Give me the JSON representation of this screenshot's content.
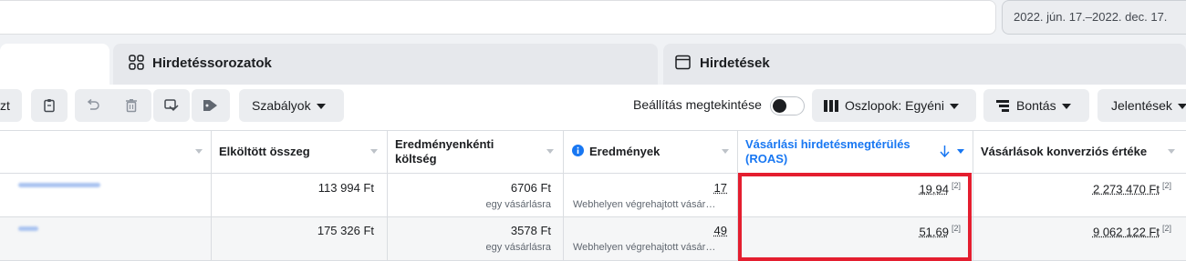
{
  "date_range": "2022. jún. 17.–2022. dec. 17.",
  "tabs": [
    {
      "label": "Hirdetéssorozatok",
      "icon": "ad-sets-grid-icon"
    },
    {
      "label": "Hirdetések",
      "icon": "ads-window-icon"
    }
  ],
  "toolbar": {
    "partial_label": "zt",
    "rules_label": "Szabályok",
    "preview_label": "Beállítás megtekintése",
    "columns_label": "Oszlopok: Egyéni",
    "breakdown_label": "Bontás",
    "reports_label": "Jelentések"
  },
  "table": {
    "headers": {
      "spent": "Elköltött összeg",
      "cost_per_result": "Eredményenkénti költség",
      "results": "Eredmények",
      "roas": "Vásárlási hirdetésmegtérülés (ROAS)",
      "conversion_value": "Vásárlások konverziós értéke"
    },
    "rows": [
      {
        "spent": "113 994 Ft",
        "cost_per_result": "6706 Ft",
        "cost_per_result_sub": "egy vásárlásra",
        "results": "17",
        "results_sub": "Webhelyen végrehajtott vásár…",
        "roas": "19,94",
        "roas_note": "[2]",
        "conversion_value": "2 273 470 Ft",
        "conversion_note": "[2]"
      },
      {
        "spent": "175 326 Ft",
        "cost_per_result": "3578 Ft",
        "cost_per_result_sub": "egy vásárlásra",
        "results": "49",
        "results_sub": "Webhelyen végrehajtott vásár…",
        "roas": "51,69",
        "roas_note": "[2]",
        "conversion_value": "9 062 122 Ft",
        "conversion_note": "[2]"
      }
    ]
  },
  "colors": {
    "accent": "#1877f2",
    "highlight": "#e41e2f"
  }
}
